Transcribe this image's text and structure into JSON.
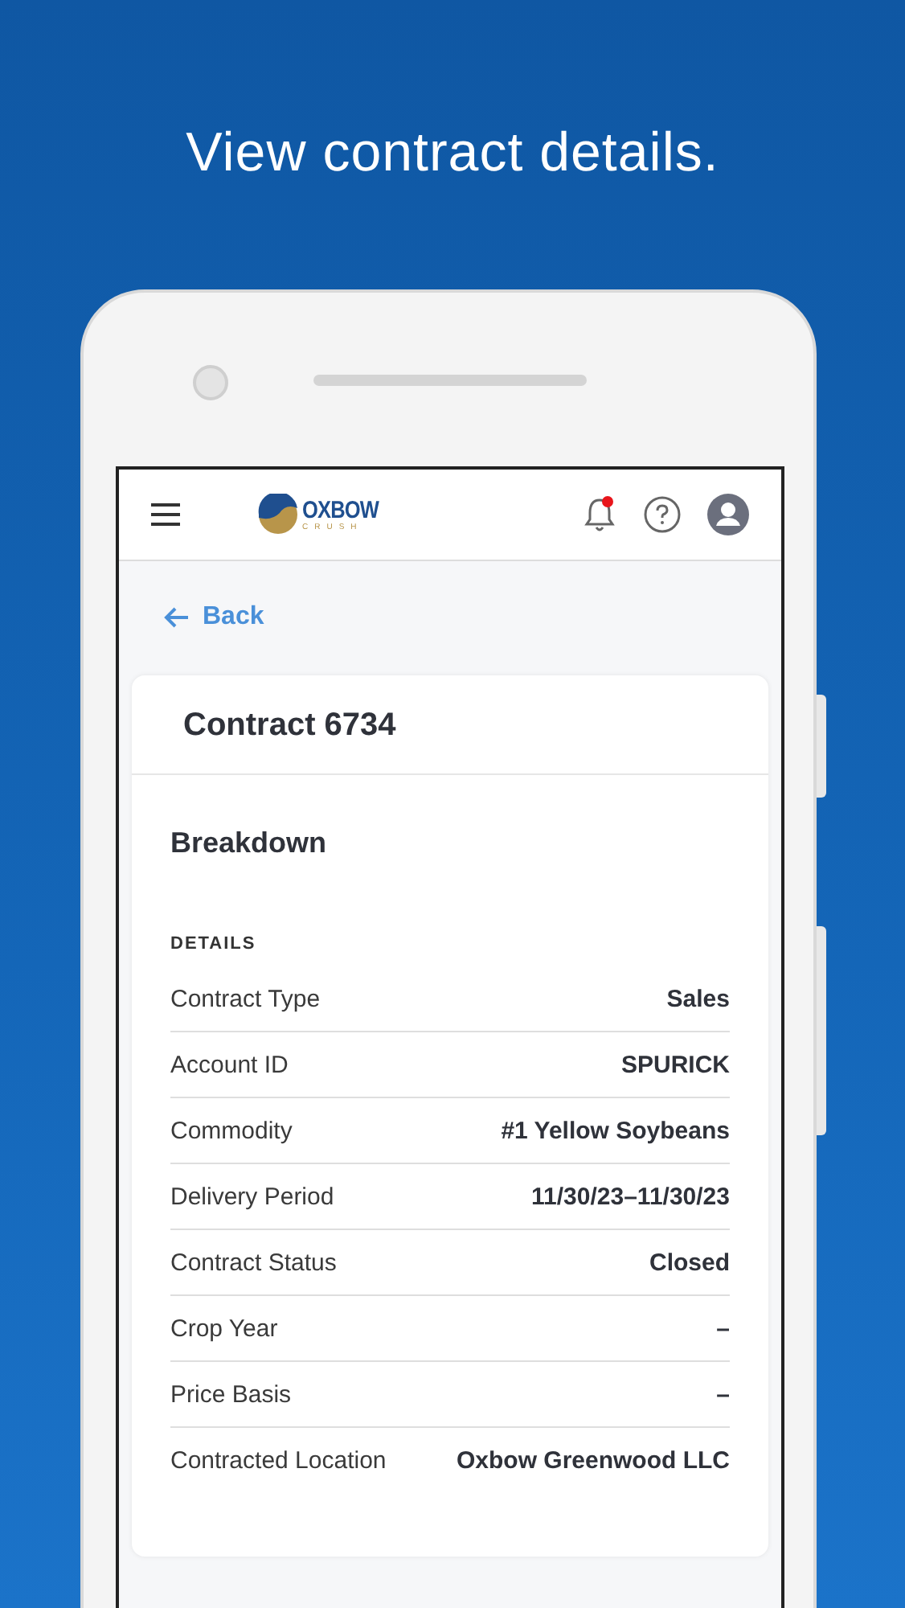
{
  "headline": "View contract details.",
  "header": {
    "logo": {
      "word": "OXBOW",
      "subword": "CRUSH"
    },
    "has_notification": true
  },
  "back": "Back",
  "card": {
    "title": "Contract 6734",
    "section": "Breakdown",
    "group": "DETAILS",
    "rows": [
      {
        "label": "Contract Type",
        "value": "Sales"
      },
      {
        "label": "Account ID",
        "value": "SPURICK"
      },
      {
        "label": "Commodity",
        "value": "#1 Yellow Soybeans"
      },
      {
        "label": "Delivery Period",
        "value": "11/30/23–11/30/23"
      },
      {
        "label": "Contract Status",
        "value": "Closed"
      },
      {
        "label": "Crop Year",
        "value": "–"
      },
      {
        "label": "Price Basis",
        "value": "–"
      },
      {
        "label": "Contracted Location",
        "value": "Oxbow Greenwood LLC"
      }
    ]
  }
}
